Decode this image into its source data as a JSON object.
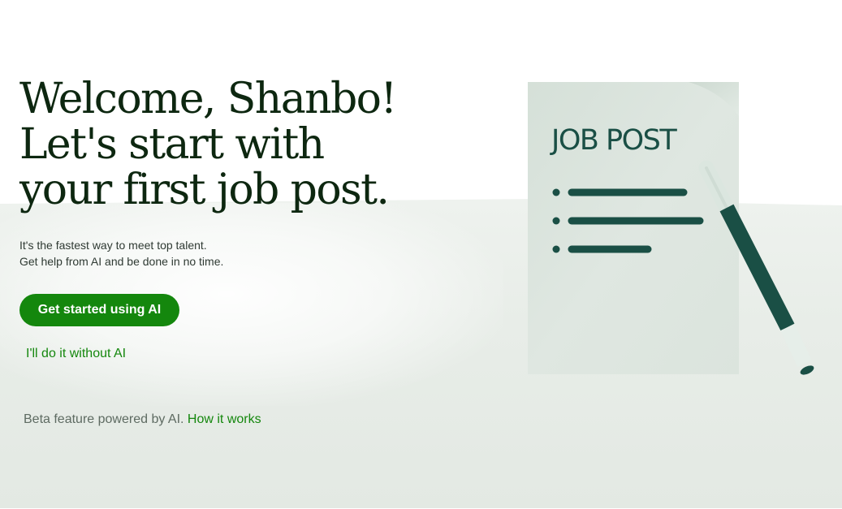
{
  "welcome": {
    "headline_lines": [
      "Welcome, Shanbo!",
      "Let's start with",
      "your first job post."
    ],
    "subtext_lines": [
      "It's the fastest way to meet top talent.",
      "Get help from AI and be done in no time."
    ],
    "primary_button": "Get started using AI",
    "secondary_link": "I'll do it without AI"
  },
  "footer": {
    "beta_text": "Beta feature powered by AI.",
    "how_it_works_link": "How it works"
  },
  "illustration": {
    "icon": "job-post-document-icon",
    "doc_title": "JOB POST"
  },
  "colors": {
    "brand_green": "#14870d",
    "headline": "#0d2710",
    "doc_accent": "#1a4f45"
  }
}
